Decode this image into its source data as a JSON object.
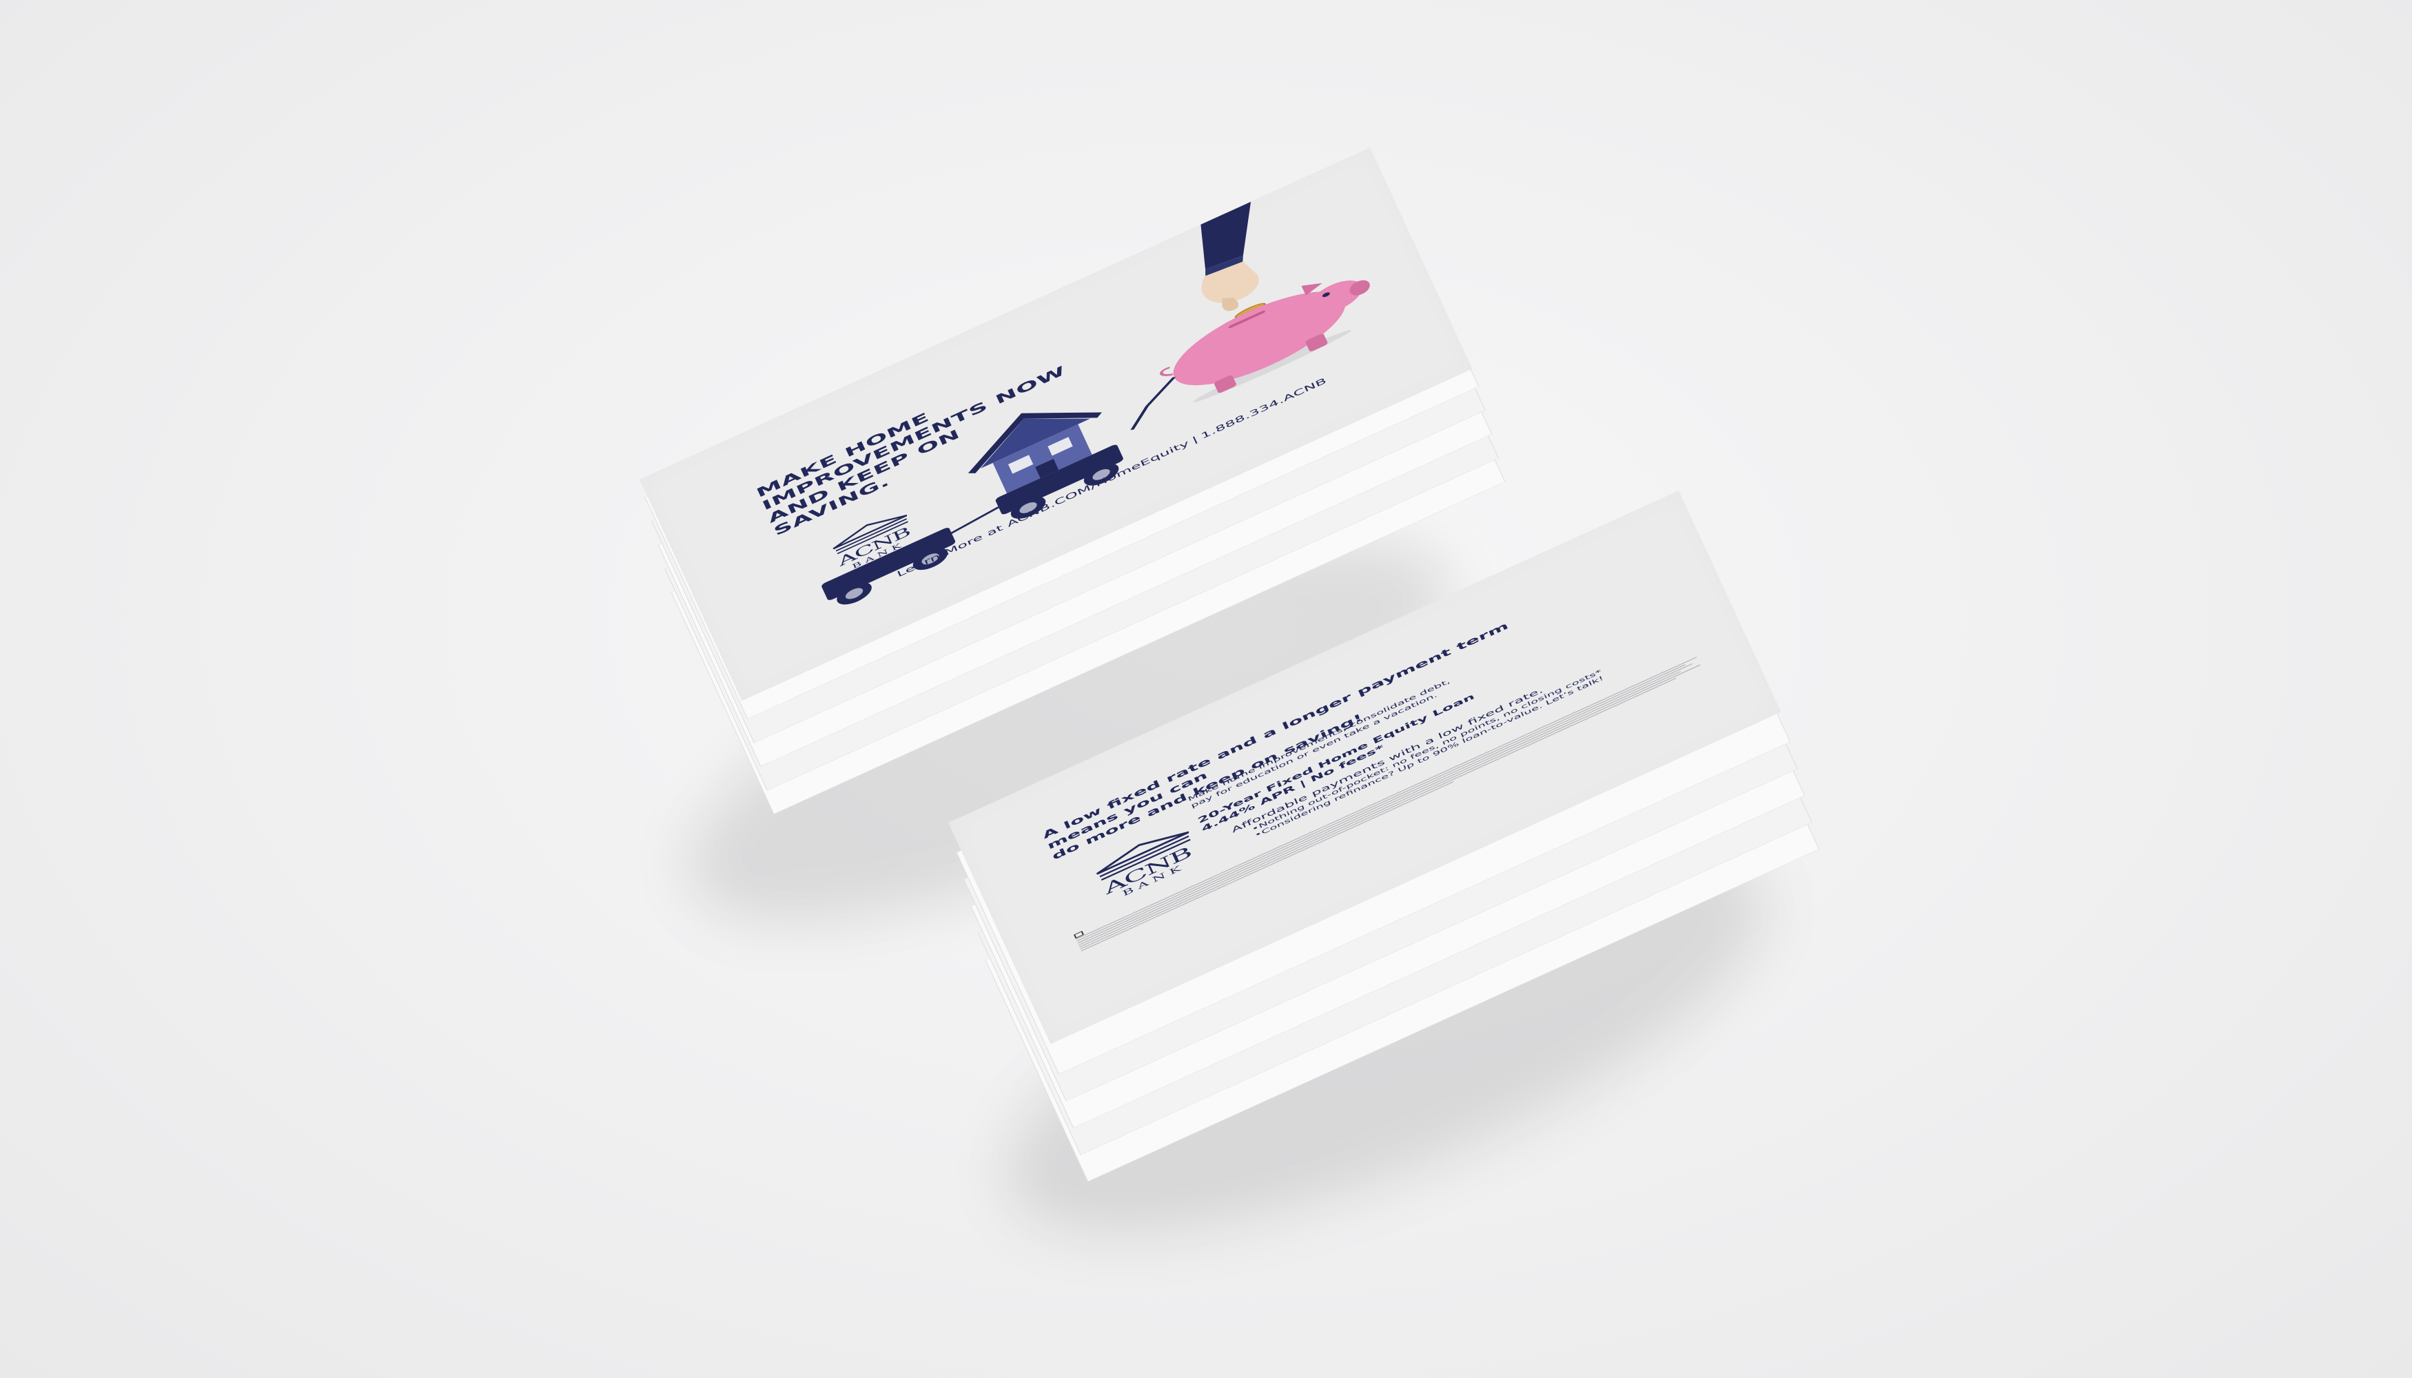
{
  "front": {
    "headline_line1": "MAKE HOME IMPROVEMENTS NOW",
    "headline_line2": "AND KEEP ON SAVING.",
    "learn_more": "Learn More at ACNB.COM/HomeEquity",
    "separator": "|",
    "phone": "1.888.334.ACNB"
  },
  "logo": {
    "name": "ACNB",
    "subname": "BANK"
  },
  "back": {
    "headline_line1": "A low fixed rate and a longer payment term means you can",
    "headline_line2": "do more and keep on saving!",
    "intro_line1": "Make home improvements, consolidate debt,",
    "intro_line2": "pay for education or even take a vacation.",
    "offer_line1": "20-Year Fixed Home Equity Loan",
    "offer_line2": "4.44% APR | No fees*",
    "benefit_lead": "Affordable payments with a low fixed rate.",
    "benefit_item1": "•Nothing out-of-pocket:  no fees, no points, no closing costs*",
    "benefit_item2": "•Considering refinance?  Up to 90% loan-to-value.  Let’s talk!"
  },
  "colors": {
    "navy": "#22285a",
    "pink": "#e98ab8",
    "gold": "#d9a441",
    "card": "#ebebeb",
    "background": "#f0f0f1"
  },
  "icons": [
    "hand-icon",
    "coin-icon",
    "piggy-bank-icon",
    "house-icon",
    "wagon-icon",
    "equal-housing-lender-icon"
  ]
}
